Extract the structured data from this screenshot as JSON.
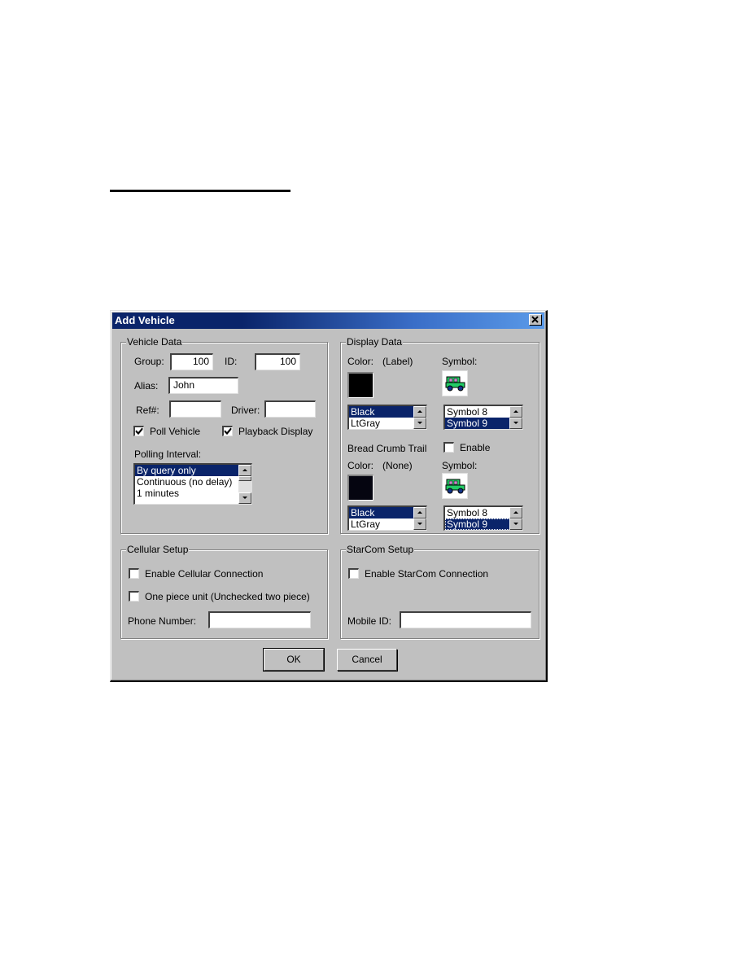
{
  "dialog": {
    "title": "Add Vehicle",
    "close_label": "✕"
  },
  "vehicle_data": {
    "group_label": "Vehicle Data",
    "group": {
      "label": "Group:",
      "value": "100"
    },
    "id": {
      "label": "ID:",
      "value": "100"
    },
    "alias": {
      "label": "Alias:",
      "value": "John"
    },
    "ref": {
      "label": "Ref#:",
      "value": ""
    },
    "driver": {
      "label": "Driver:",
      "value": ""
    },
    "poll_vehicle": {
      "label": "Poll Vehicle",
      "checked": true
    },
    "playback_display": {
      "label": "Playback Display",
      "checked": true
    },
    "polling_interval": {
      "label": "Polling Interval:",
      "options": [
        "By query only",
        "Continuous (no delay)",
        "1 minutes"
      ],
      "selected": "By query only"
    }
  },
  "display_data": {
    "group_label": "Display Data",
    "color_label": "Color:",
    "color_note": "(Label)",
    "color_swatch": "#000000",
    "color_options": [
      "Black",
      "LtGray"
    ],
    "color_selected": "Black",
    "symbol_label": "Symbol:",
    "symbol_icon": "green-jeep-icon",
    "symbol_options": [
      "Symbol 8",
      "Symbol 9"
    ],
    "symbol_selected": "Symbol 9",
    "bread_crumb_label": "Bread Crumb Trail",
    "enable": {
      "label": "Enable",
      "checked": false
    },
    "trail_color_label": "Color:",
    "trail_color_note": "(None)",
    "trail_color_swatch": "#000000",
    "trail_color_options": [
      "Black",
      "LtGray"
    ],
    "trail_color_selected": "Black",
    "trail_symbol_label": "Symbol:",
    "trail_symbol_icon": "green-jeep-icon",
    "trail_symbol_options": [
      "Symbol 8",
      "Symbol 9"
    ],
    "trail_symbol_selected": "Symbol 9"
  },
  "cellular_setup": {
    "group_label": "Cellular Setup",
    "enable_cellular": {
      "label": "Enable Cellular Connection",
      "checked": false
    },
    "one_piece": {
      "label": "One piece unit (Unchecked two piece)",
      "checked": false
    },
    "phone_number": {
      "label": "Phone Number:",
      "value": ""
    }
  },
  "starcom_setup": {
    "group_label": "StarCom Setup",
    "enable_starcom": {
      "label": "Enable StarCom Connection",
      "checked": false
    },
    "mobile_id": {
      "label": "Mobile ID:",
      "value": ""
    }
  },
  "buttons": {
    "ok": "OK",
    "cancel": "Cancel"
  },
  "colors": {
    "title_bar_start": "#0a246a",
    "title_bar_end": "#5a9ae8",
    "selection": "#0a246a",
    "dialog_face": "#c0c0c0",
    "jeep_body": "#22cc66"
  }
}
